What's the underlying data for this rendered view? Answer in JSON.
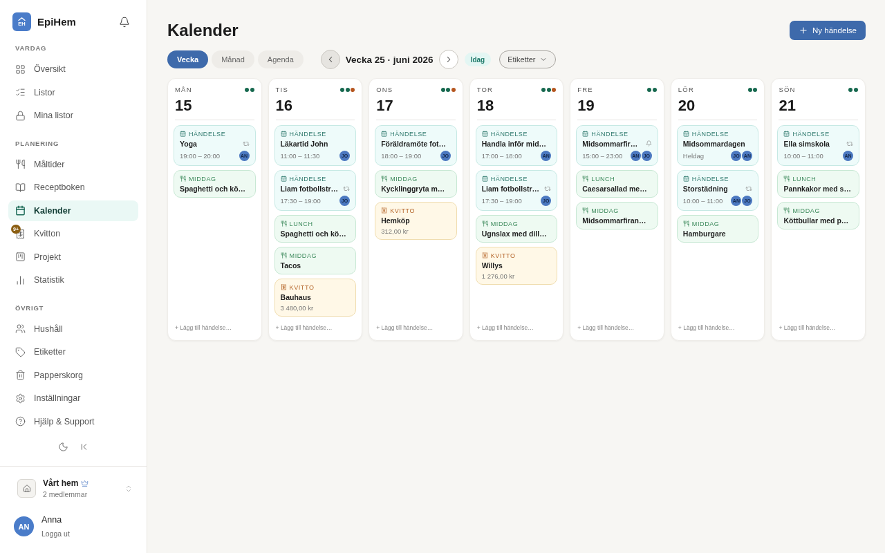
{
  "sidebar": {
    "brand": {
      "logo_text": "EH",
      "name": "EpiHem"
    },
    "sections": [
      {
        "title": "VARDAG",
        "items": [
          {
            "label": "Översikt",
            "selected": false
          },
          {
            "label": "Listor",
            "selected": false
          },
          {
            "label": "Mina listor",
            "selected": false
          }
        ]
      },
      {
        "title": "PLANERING",
        "items": [
          {
            "label": "Måltider",
            "selected": false
          },
          {
            "label": "Receptboken",
            "selected": false
          },
          {
            "label": "Kalender",
            "selected": true
          },
          {
            "label": "Kvitton",
            "selected": false,
            "badge": "9+"
          },
          {
            "label": "Projekt",
            "selected": false
          },
          {
            "label": "Statistik",
            "selected": false
          }
        ]
      },
      {
        "title": "ÖVRIGT",
        "items": [
          {
            "label": "Hushåll",
            "selected": false
          },
          {
            "label": "Etiketter",
            "selected": false
          },
          {
            "label": "Papperskorg",
            "selected": false
          },
          {
            "label": "Inställningar",
            "selected": false
          },
          {
            "label": "Hjälp & Support",
            "selected": false
          }
        ]
      }
    ],
    "household": {
      "name": "Vårt hem",
      "members": "2 medlemmar"
    },
    "user": {
      "initials": "AN",
      "name": "Anna",
      "action": "Logga ut"
    }
  },
  "header": {
    "title": "Kalender",
    "new_button": "Ny händelse"
  },
  "toolbar": {
    "view_tabs": [
      {
        "label": "Vecka",
        "selected": true
      },
      {
        "label": "Månad",
        "selected": false
      },
      {
        "label": "Agenda",
        "selected": false
      }
    ],
    "previous": {
      "highlighted": true
    },
    "week_label": "Vecka 25 · juni 2026",
    "next": {
      "highlighted": false
    },
    "today": "Idag",
    "filter": "Etiketter"
  },
  "days": [
    {
      "weekday": "MÅN",
      "date": "15",
      "dots": [
        {
          "color": "#17694f"
        },
        {
          "color": "#17694f"
        }
      ],
      "entries": [
        {
          "kind": "event",
          "category": "HÄNDELSE",
          "title": "Yoga",
          "time": "19:00 – 20:00",
          "recurring": true,
          "reminder": false,
          "people": [
            "AN"
          ]
        },
        {
          "kind": "meal",
          "category": "MIDDAG",
          "title": "Spaghetti och kö…"
        }
      ],
      "add_placeholder": "+ Lägg till händelse…"
    },
    {
      "weekday": "TIS",
      "date": "16",
      "dots": [
        {
          "color": "#17694f"
        },
        {
          "color": "#17694f"
        },
        {
          "color": "#b5561f"
        }
      ],
      "entries": [
        {
          "kind": "event",
          "category": "HÄNDELSE",
          "title": "Läkartid John",
          "time": "11:00 – 11:30",
          "recurring": false,
          "reminder": false,
          "people": [
            "JO"
          ]
        },
        {
          "kind": "event",
          "category": "HÄNDELSE",
          "title": "Liam fotbollstr…",
          "time": "17:30 – 19:00",
          "recurring": true,
          "reminder": false,
          "people": [
            "JO"
          ]
        },
        {
          "kind": "meal",
          "category": "LUNCH",
          "title": "Spaghetti och kö…"
        },
        {
          "kind": "meal",
          "category": "MIDDAG",
          "title": "Tacos"
        },
        {
          "kind": "receipt",
          "category": "KVITTO",
          "title": "Bauhaus",
          "amount": "3 480,00 kr"
        }
      ],
      "add_placeholder": "+ Lägg till händelse…"
    },
    {
      "weekday": "ONS",
      "date": "17",
      "dots": [
        {
          "color": "#17694f"
        },
        {
          "color": "#17694f"
        },
        {
          "color": "#b5561f"
        }
      ],
      "entries": [
        {
          "kind": "event",
          "category": "HÄNDELSE",
          "title": "Föräldramöte fot…",
          "time": "18:00 – 19:00",
          "recurring": false,
          "reminder": false,
          "people": [
            "JO"
          ]
        },
        {
          "kind": "meal",
          "category": "MIDDAG",
          "title": "Kycklinggryta m…"
        },
        {
          "kind": "receipt",
          "category": "KVITTO",
          "title": "Hemköp",
          "amount": "312,00 kr"
        }
      ],
      "add_placeholder": "+ Lägg till händelse…"
    },
    {
      "weekday": "TOR",
      "date": "18",
      "dots": [
        {
          "color": "#17694f"
        },
        {
          "color": "#17694f"
        },
        {
          "color": "#b5561f"
        }
      ],
      "entries": [
        {
          "kind": "event",
          "category": "HÄNDELSE",
          "title": "Handla inför mid…",
          "time": "17:00 – 18:00",
          "recurring": false,
          "reminder": false,
          "people": [
            "AN"
          ]
        },
        {
          "kind": "event",
          "category": "HÄNDELSE",
          "title": "Liam fotbollstr…",
          "time": "17:30 – 19:00",
          "recurring": true,
          "reminder": false,
          "people": [
            "JO"
          ]
        },
        {
          "kind": "meal",
          "category": "MIDDAG",
          "title": "Ugnslax med dill…"
        },
        {
          "kind": "receipt",
          "category": "KVITTO",
          "title": "Willys",
          "amount": "1 276,00 kr"
        }
      ],
      "add_placeholder": "+ Lägg till händelse…"
    },
    {
      "weekday": "FRE",
      "date": "19",
      "dots": [
        {
          "color": "#17694f"
        },
        {
          "color": "#17694f"
        }
      ],
      "entries": [
        {
          "kind": "event",
          "category": "HÄNDELSE",
          "title": "Midsommarfir…",
          "time": "15:00 – 23:00",
          "recurring": false,
          "reminder": true,
          "people": [
            "AN",
            "JO"
          ]
        },
        {
          "kind": "meal",
          "category": "LUNCH",
          "title": "Caesarsallad me…"
        },
        {
          "kind": "meal",
          "category": "MIDDAG",
          "title": "Midsommarfiran…"
        }
      ],
      "add_placeholder": "+ Lägg till händelse…"
    },
    {
      "weekday": "LÖR",
      "date": "20",
      "dots": [
        {
          "color": "#17694f"
        },
        {
          "color": "#17694f"
        }
      ],
      "entries": [
        {
          "kind": "event",
          "category": "HÄNDELSE",
          "title": "Midsommardagen",
          "time": "Heldag",
          "recurring": false,
          "reminder": false,
          "people": [
            "JO",
            "AN"
          ]
        },
        {
          "kind": "event",
          "category": "HÄNDELSE",
          "title": "Storstädning",
          "time": "10:00 – 11:00",
          "recurring": true,
          "reminder": false,
          "people": [
            "AN",
            "JO"
          ]
        },
        {
          "kind": "meal",
          "category": "MIDDAG",
          "title": "Hamburgare"
        }
      ],
      "add_placeholder": "+ Lägg till händelse…"
    },
    {
      "weekday": "SÖN",
      "date": "21",
      "dots": [
        {
          "color": "#17694f"
        },
        {
          "color": "#17694f"
        }
      ],
      "entries": [
        {
          "kind": "event",
          "category": "HÄNDELSE",
          "title": "Ella simskola",
          "time": "10:00 – 11:00",
          "recurring": true,
          "reminder": false,
          "people": [
            "AN"
          ]
        },
        {
          "kind": "meal",
          "category": "LUNCH",
          "title": "Pannkakor med s…"
        },
        {
          "kind": "meal",
          "category": "MIDDAG",
          "title": "Köttbullar med p…"
        }
      ],
      "add_placeholder": "+ Lägg till händelse…"
    }
  ]
}
